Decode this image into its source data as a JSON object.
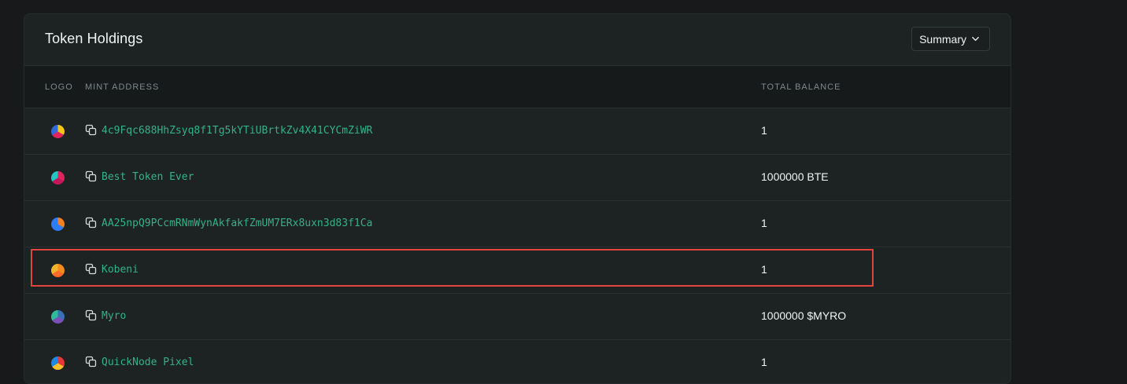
{
  "card": {
    "title": "Token Holdings",
    "view_select": {
      "label": "Summary",
      "icon": "chevron-down-icon"
    }
  },
  "table": {
    "columns": {
      "logo": "LOGO",
      "mint": "MINT ADDRESS",
      "balance": "TOTAL BALANCE"
    },
    "rows": [
      {
        "mint": "4c9Fqc688HhZsyq8f1Tg5kYTiUBrtkZv4X41CYCmZiWR",
        "balance": "1",
        "logo_colors": [
          "#f5c518",
          "#e0245e",
          "#2f6bd8"
        ]
      },
      {
        "mint": "Best Token Ever",
        "balance": "1000000 BTE",
        "logo_colors": [
          "#e0245e",
          "#c2185b",
          "#20c7c2"
        ]
      },
      {
        "mint": "AA25npQ9PCcmRNmWynAkfakfZmUM7ERx8uxn3d83f1Ca",
        "balance": "1",
        "logo_colors": [
          "#f48024",
          "#2e7cf6",
          "#2e7cf6"
        ]
      },
      {
        "mint": "Kobeni",
        "balance": "1",
        "logo_colors": [
          "#f58a1f",
          "#ff6a2a",
          "#f2b52a"
        ]
      },
      {
        "mint": "Myro",
        "balance": "1000000 $MYRO",
        "logo_colors": [
          "#3b6fb8",
          "#7a4fb8",
          "#2dbd9a"
        ]
      },
      {
        "mint": "QuickNode Pixel",
        "balance": "1",
        "logo_colors": [
          "#e53935",
          "#fbc02d",
          "#1e88e5"
        ]
      }
    ]
  },
  "highlight": {
    "row_index": 3,
    "color": "#e2453d"
  }
}
